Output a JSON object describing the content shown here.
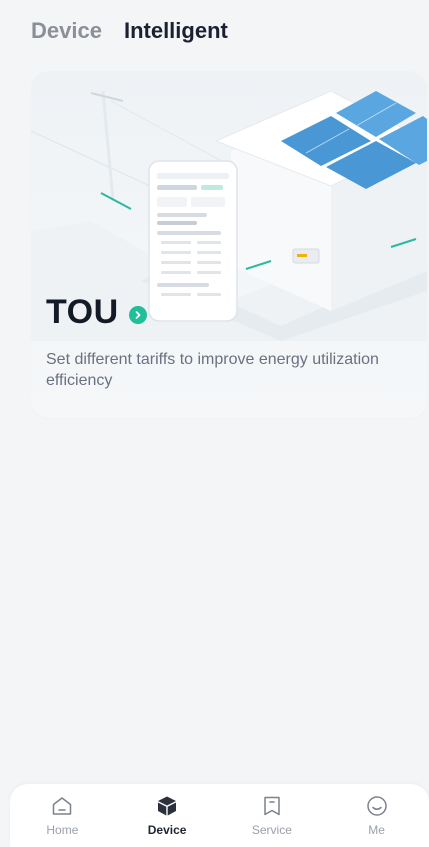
{
  "header": {
    "tabs": [
      {
        "label": "Device",
        "active": false
      },
      {
        "label": "Intelligent",
        "active": true
      }
    ]
  },
  "card": {
    "title": "TOU",
    "description": "Set different tariffs to improve energy utilization efficiency",
    "accent_color": "#1fbf97"
  },
  "bottom_nav": {
    "items": [
      {
        "label": "Home",
        "icon": "home-icon",
        "active": false
      },
      {
        "label": "Device",
        "icon": "cube-icon",
        "active": true
      },
      {
        "label": "Service",
        "icon": "bookmark-icon",
        "active": false
      },
      {
        "label": "Me",
        "icon": "smile-icon",
        "active": false
      }
    ]
  }
}
